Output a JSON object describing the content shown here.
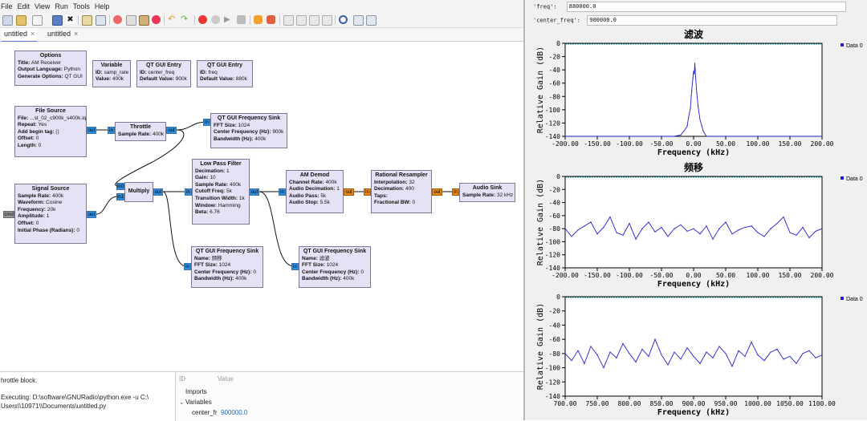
{
  "menu": [
    "File",
    "Edit",
    "View",
    "Run",
    "Tools",
    "Help"
  ],
  "tabs": [
    {
      "label": "untitled",
      "close": "×"
    },
    {
      "label": "untitled",
      "close": "×"
    }
  ],
  "blocks": {
    "options": {
      "title": "Options",
      "rows": [
        {
          "k": "Title:",
          "v": " AM Receiver"
        },
        {
          "k": "Output Language:",
          "v": " Python"
        },
        {
          "k": "Generate Options:",
          "v": " QT GUI"
        }
      ]
    },
    "variable": {
      "title": "Variable",
      "rows": [
        {
          "k": "ID:",
          "v": " samp_rate"
        },
        {
          "k": "Value:",
          "v": " 400k"
        }
      ]
    },
    "entry1": {
      "title": "QT GUI Entry",
      "rows": [
        {
          "k": "ID:",
          "v": " center_freq"
        },
        {
          "k": "Default Value:",
          "v": " 900k"
        }
      ]
    },
    "entry2": {
      "title": "QT GUI Entry",
      "rows": [
        {
          "k": "ID:",
          "v": " freq"
        },
        {
          "k": "Default Value:",
          "v": " 880k"
        }
      ]
    },
    "filesource": {
      "title": "File Source",
      "rows": [
        {
          "k": "File:",
          "v": " ...st_02_c900k_s400k.iq"
        },
        {
          "k": "Repeat:",
          "v": " Yes"
        },
        {
          "k": "Add begin tag:",
          "v": " ()"
        },
        {
          "k": "Offset:",
          "v": " 0"
        },
        {
          "k": "Length:",
          "v": " 0"
        }
      ]
    },
    "throttle": {
      "title": "Throttle",
      "rows": [
        {
          "k": "Sample Rate:",
          "v": " 400k"
        }
      ]
    },
    "fsink1": {
      "title": "QT GUI Frequency Sink",
      "rows": [
        {
          "k": "FFT Size:",
          "v": " 1024"
        },
        {
          "k": "Center Frequency (Hz):",
          "v": " 900k"
        },
        {
          "k": "Bandwidth (Hz):",
          "v": " 400k"
        }
      ]
    },
    "lpf": {
      "title": "Low Pass Filter",
      "rows": [
        {
          "k": "Decimation:",
          "v": " 1"
        },
        {
          "k": "Gain:",
          "v": " 10"
        },
        {
          "k": "Sample Rate:",
          "v": " 400k"
        },
        {
          "k": "Cutoff Freq:",
          "v": " 5k"
        },
        {
          "k": "Transition Width:",
          "v": " 1k"
        },
        {
          "k": "Window:",
          "v": " Hamming"
        },
        {
          "k": "Beta:",
          "v": " 6.76"
        }
      ]
    },
    "amdemod": {
      "title": "AM Demod",
      "rows": [
        {
          "k": "Channel Rate:",
          "v": " 400k"
        },
        {
          "k": "Audio Decimation:",
          "v": " 1"
        },
        {
          "k": "Audio Pass:",
          "v": " 5k"
        },
        {
          "k": "Audio Stop:",
          "v": " 5.5k"
        }
      ]
    },
    "resampler": {
      "title": "Rational Resampler",
      "rows": [
        {
          "k": "Interpolation:",
          "v": " 32"
        },
        {
          "k": "Decimation:",
          "v": " 400"
        },
        {
          "k": "Taps:",
          "v": ""
        },
        {
          "k": "Fractional BW:",
          "v": " 0"
        }
      ]
    },
    "audiosink": {
      "title": "Audio Sink",
      "rows": [
        {
          "k": "Sample Rate:",
          "v": " 32 kHz"
        }
      ]
    },
    "sigsource": {
      "title": "Signal Source",
      "rows": [
        {
          "k": "Sample Rate:",
          "v": " 400k"
        },
        {
          "k": "Waveform:",
          "v": " Cosine"
        },
        {
          "k": "Frequency:",
          "v": " 20k"
        },
        {
          "k": "Amplitude:",
          "v": " 1"
        },
        {
          "k": "Offset:",
          "v": " 0"
        },
        {
          "k": "Initial Phase (Radians):",
          "v": " 0"
        }
      ]
    },
    "multiply": {
      "title": "Multiply",
      "rows": []
    },
    "fsink2": {
      "title": "QT GUI Frequency Sink",
      "rows": [
        {
          "k": "Name:",
          "v": " 频移"
        },
        {
          "k": "FFT Size:",
          "v": " 1024"
        },
        {
          "k": "Center Frequency (Hz):",
          "v": " 0"
        },
        {
          "k": "Bandwidth (Hz):",
          "v": " 400k"
        }
      ]
    },
    "fsink3": {
      "title": "QT GUI Frequency Sink",
      "rows": [
        {
          "k": "Name:",
          "v": " 滤波"
        },
        {
          "k": "FFT Size:",
          "v": " 1024"
        },
        {
          "k": "Center Frequency (Hz):",
          "v": " 0"
        },
        {
          "k": "Bandwidth (Hz):",
          "v": " 400k"
        }
      ]
    }
  },
  "ports": {
    "in": "in",
    "out": "out",
    "in0": "in0",
    "in1": "in1",
    "cmd": "cmd"
  },
  "console": {
    "line1": "hrottle block.",
    "line2": "Executing: D:\\software\\GNURadio\\python.exe -u C:\\",
    "line3": "Users\\\\10971\\\\Documents\\untitled.py"
  },
  "variables": {
    "col_id": "ID",
    "col_value": "Value",
    "imports": "Imports",
    "variables": "Variables",
    "row_name": "center_fr",
    "row_value": "900000.0"
  },
  "qt": {
    "entries": [
      {
        "label": "'freq':",
        "value": "880000.0"
      },
      {
        "label": "'center_freq':",
        "value": "900000.0"
      }
    ]
  },
  "chart_data": [
    {
      "type": "line",
      "title": "滤波",
      "xlabel": "Frequency (kHz)",
      "ylabel": "Relative Gain (dB)",
      "xlim": [
        -200,
        200
      ],
      "ylim": [
        -140,
        0
      ],
      "xticks": [
        "-200.00",
        "-150.00",
        "-100.00",
        "-50.00",
        "0.00",
        "50.00",
        "100.00",
        "150.00",
        "200.00"
      ],
      "yticks": [
        "0",
        "-20",
        "-40",
        "-60",
        "-80",
        "-100",
        "-120",
        "-140"
      ],
      "legend": "Data 0",
      "legend_position": "top-right",
      "color": "#1f1fcf",
      "series": [
        {
          "name": "Data 0",
          "x": [
            -200,
            -30,
            -20,
            -15,
            -10,
            -8,
            -5,
            -3,
            -1,
            0,
            1,
            2,
            3,
            5,
            7,
            10,
            13,
            15,
            20,
            30,
            200
          ],
          "y": [
            -150,
            -150,
            -138,
            -132,
            -125,
            -112,
            -98,
            -72,
            -52,
            -42,
            -46,
            -30,
            -50,
            -75,
            -95,
            -115,
            -125,
            -132,
            -140,
            -150,
            -150
          ]
        }
      ]
    },
    {
      "type": "line",
      "title": "频移",
      "xlabel": "Frequency (kHz)",
      "ylabel": "Relative Gain (dB)",
      "xlim": [
        -200,
        200
      ],
      "ylim": [
        -140,
        0
      ],
      "xticks": [
        "-200.00",
        "-150.00",
        "-100.00",
        "-50.00",
        "0.00",
        "50.00",
        "100.00",
        "150.00",
        "200.00"
      ],
      "yticks": [
        "0",
        "-20",
        "-40",
        "-60",
        "-80",
        "-100",
        "-120",
        "-140"
      ],
      "legend": "Data 0",
      "legend_position": "top-right",
      "color": "#1f1fcf",
      "series": [
        {
          "name": "Data 0",
          "x": [
            -200,
            -190,
            -180,
            -170,
            -160,
            -150,
            -140,
            -130,
            -120,
            -110,
            -100,
            -90,
            -80,
            -70,
            -60,
            -50,
            -40,
            -30,
            -20,
            -10,
            0,
            10,
            20,
            30,
            40,
            50,
            60,
            70,
            80,
            90,
            100,
            110,
            120,
            130,
            140,
            150,
            160,
            170,
            180,
            190,
            200
          ],
          "y": [
            -80,
            -92,
            -82,
            -76,
            -70,
            -88,
            -78,
            -62,
            -86,
            -90,
            -72,
            -96,
            -80,
            -70,
            -85,
            -78,
            -92,
            -80,
            -74,
            -84,
            -80,
            -88,
            -76,
            -96,
            -80,
            -70,
            -88,
            -82,
            -78,
            -76,
            -86,
            -92,
            -80,
            -72,
            -62,
            -86,
            -90,
            -78,
            -94,
            -84,
            -80
          ]
        }
      ]
    },
    {
      "type": "line",
      "title": "",
      "xlabel": "Frequency (kHz)",
      "ylabel": "Relative Gain (dB)",
      "xlim": [
        700,
        1100
      ],
      "ylim": [
        -140,
        0
      ],
      "xticks": [
        "700.00",
        "750.00",
        "800.00",
        "850.00",
        "900.00",
        "950.00",
        "1000.00",
        "1050.00",
        "1100.00"
      ],
      "yticks": [
        "0",
        "-20",
        "-40",
        "-60",
        "-80",
        "-100",
        "-120",
        "-140"
      ],
      "legend": "Data 0",
      "legend_position": "top-right",
      "color": "#1f1fcf",
      "series": [
        {
          "name": "Data 0",
          "x": [
            700,
            710,
            720,
            730,
            740,
            750,
            760,
            770,
            780,
            790,
            800,
            810,
            820,
            830,
            840,
            850,
            860,
            870,
            880,
            890,
            900,
            910,
            920,
            930,
            940,
            950,
            960,
            970,
            980,
            990,
            1000,
            1010,
            1020,
            1030,
            1040,
            1050,
            1060,
            1070,
            1080,
            1090,
            1100
          ],
          "y": [
            -80,
            -90,
            -76,
            -94,
            -70,
            -82,
            -100,
            -78,
            -86,
            -66,
            -80,
            -92,
            -74,
            -84,
            -60,
            -82,
            -96,
            -78,
            -88,
            -72,
            -84,
            -94,
            -78,
            -86,
            -70,
            -80,
            -98,
            -76,
            -84,
            -64,
            -82,
            -90,
            -78,
            -74,
            -88,
            -84,
            -94,
            -80,
            -76,
            -86,
            -82
          ]
        }
      ]
    }
  ]
}
